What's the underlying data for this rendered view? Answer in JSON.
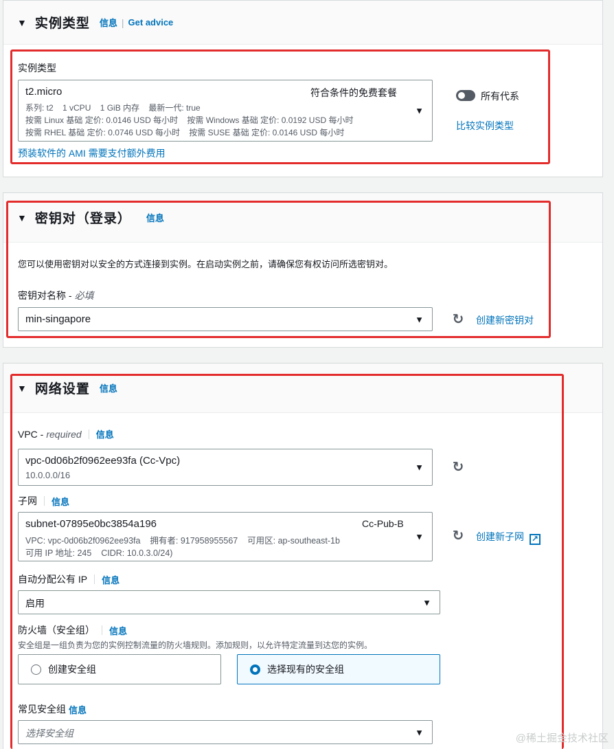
{
  "instance_section": {
    "title": "实例类型",
    "info": "信息",
    "get_advice": "Get advice",
    "field_label": "实例类型",
    "instance": "t2.micro",
    "free_tier": "符合条件的免费套餐",
    "line1": "系列: t2    1 vCPU    1 GiB 内存    最新一代: true",
    "line2": "按需 Linux 基础 定价: 0.0146 USD 每小时    按需 Windows 基础 定价: 0.0192 USD 每小时",
    "line3": "按需 RHEL 基础 定价: 0.0746 USD 每小时    按需 SUSE 基础 定价: 0.0146 USD 每小时",
    "ami_note": "预装软件的 AMI 需要支付额外费用",
    "all_gens": "所有代系",
    "compare": "比较实例类型"
  },
  "keypair_section": {
    "title": "密钥对（登录）",
    "info": "信息",
    "description": "您可以使用密钥对以安全的方式连接到实例。在启动实例之前，请确保您有权访问所选密钥对。",
    "field_label": "密钥对名称 -",
    "required": "必填",
    "value": "min-singapore",
    "create_link": "创建新密钥对"
  },
  "network_section": {
    "title": "网络设置",
    "info": "信息",
    "vpc_label": "VPC -",
    "vpc_required": "required",
    "vpc_value": "vpc-0d06b2f0962ee93fa (Cc-Vpc)",
    "vpc_cidr": "10.0.0.0/16",
    "subnet_label": "子网",
    "subnet_value": "subnet-07895e0bc3854a196",
    "subnet_name": "Cc-Pub-B",
    "subnet_line1": "VPC: vpc-0d06b2f0962ee93fa    拥有者: 917958955567    可用区: ap-southeast-1b",
    "subnet_line2": "可用 IP 地址: 245    CIDR: 10.0.3.0/24)",
    "create_subnet": "创建新子网",
    "public_ip_label": "自动分配公有 IP",
    "public_ip_value": "启用",
    "firewall_label": "防火墙（安全组）",
    "firewall_desc": "安全组是一组负责为您的实例控制流量的防火墙规则。添加规则，以允许特定流量到达您的实例。",
    "create_sg": "创建安全组",
    "select_sg": "选择现有的安全组",
    "common_sg_label": "常见安全组",
    "sg_placeholder": "选择安全组"
  },
  "watermark": "@稀土掘金技术社区",
  "icons": {
    "caret": "▼",
    "arrow": "▼",
    "refresh": "↻",
    "external": "↗"
  },
  "colors": {
    "link": "#0073bb",
    "highlight": "#e32b2b"
  }
}
